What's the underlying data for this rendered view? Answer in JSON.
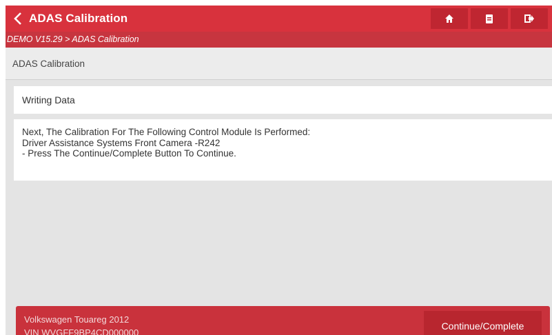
{
  "header": {
    "title": "ADAS Calibration",
    "back_icon": "chevron-left-icon",
    "buttons": [
      {
        "icon": "home-icon"
      },
      {
        "icon": "print-icon"
      },
      {
        "icon": "exit-icon"
      }
    ]
  },
  "breadcrumb": "DEMO V15.29 > ADAS Calibration",
  "subheader": "ADAS Calibration",
  "card": {
    "title": "Writing Data",
    "lines": [
      "Next, The Calibration For The Following Control Module Is Performed:",
      "Driver Assistance Systems Front Camera -R242",
      "- Press The Continue/Complete Button To Continue."
    ]
  },
  "footer": {
    "vehicle": "Volkswagen Touareg 2012",
    "vin": "VIN WVGFF9BP4CD000000",
    "continue_label": "Continue/Complete"
  },
  "colors": {
    "primary": "#d8323d",
    "primary_dark": "#bf2631",
    "background": "#e4e4e4"
  }
}
